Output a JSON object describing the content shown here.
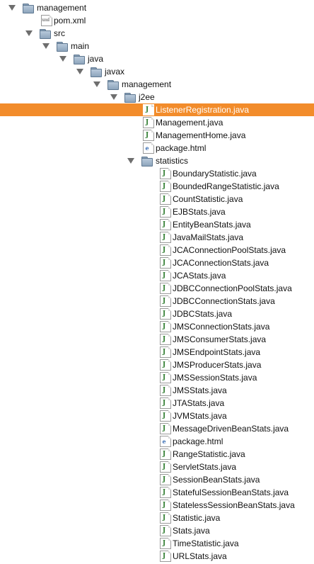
{
  "tree": {
    "items": [
      {
        "label": "management",
        "kind": "folder",
        "depth": 0,
        "expanded": true,
        "icon": "folder-icon",
        "selected": false
      },
      {
        "label": "pom.xml",
        "kind": "file",
        "filetype": "xml",
        "depth": 1,
        "icon": "xml-file-icon",
        "selected": false
      },
      {
        "label": "src",
        "kind": "folder",
        "depth": 1,
        "expanded": true,
        "icon": "folder-icon",
        "selected": false
      },
      {
        "label": "main",
        "kind": "folder",
        "depth": 2,
        "expanded": true,
        "icon": "folder-icon",
        "selected": false
      },
      {
        "label": "java",
        "kind": "folder",
        "depth": 3,
        "expanded": true,
        "icon": "folder-icon",
        "selected": false
      },
      {
        "label": "javax",
        "kind": "folder",
        "depth": 4,
        "expanded": true,
        "icon": "folder-icon",
        "selected": false
      },
      {
        "label": "management",
        "kind": "folder",
        "depth": 5,
        "expanded": true,
        "icon": "folder-icon",
        "selected": false
      },
      {
        "label": "j2ee",
        "kind": "folder",
        "depth": 6,
        "expanded": true,
        "icon": "folder-icon",
        "selected": false
      },
      {
        "label": "ListenerRegistration.java",
        "kind": "file",
        "filetype": "java",
        "depth": 7,
        "icon": "java-file-icon",
        "selected": true
      },
      {
        "label": "Management.java",
        "kind": "file",
        "filetype": "java",
        "depth": 7,
        "icon": "java-file-icon",
        "selected": false
      },
      {
        "label": "ManagementHome.java",
        "kind": "file",
        "filetype": "java",
        "depth": 7,
        "icon": "java-file-icon",
        "selected": false
      },
      {
        "label": "package.html",
        "kind": "file",
        "filetype": "html",
        "depth": 7,
        "icon": "html-file-icon",
        "selected": false
      },
      {
        "label": "statistics",
        "kind": "folder",
        "depth": 7,
        "expanded": true,
        "icon": "folder-icon",
        "selected": false
      },
      {
        "label": "BoundaryStatistic.java",
        "kind": "file",
        "filetype": "java",
        "depth": 8,
        "icon": "java-file-icon",
        "selected": false
      },
      {
        "label": "BoundedRangeStatistic.java",
        "kind": "file",
        "filetype": "java",
        "depth": 8,
        "icon": "java-file-icon",
        "selected": false
      },
      {
        "label": "CountStatistic.java",
        "kind": "file",
        "filetype": "java",
        "depth": 8,
        "icon": "java-file-icon",
        "selected": false
      },
      {
        "label": "EJBStats.java",
        "kind": "file",
        "filetype": "java",
        "depth": 8,
        "icon": "java-file-icon",
        "selected": false
      },
      {
        "label": "EntityBeanStats.java",
        "kind": "file",
        "filetype": "java",
        "depth": 8,
        "icon": "java-file-icon",
        "selected": false
      },
      {
        "label": "JavaMailStats.java",
        "kind": "file",
        "filetype": "java",
        "depth": 8,
        "icon": "java-file-icon",
        "selected": false
      },
      {
        "label": "JCAConnectionPoolStats.java",
        "kind": "file",
        "filetype": "java",
        "depth": 8,
        "icon": "java-file-icon",
        "selected": false
      },
      {
        "label": "JCAConnectionStats.java",
        "kind": "file",
        "filetype": "java",
        "depth": 8,
        "icon": "java-file-icon",
        "selected": false
      },
      {
        "label": "JCAStats.java",
        "kind": "file",
        "filetype": "java",
        "depth": 8,
        "icon": "java-file-icon",
        "selected": false
      },
      {
        "label": "JDBCConnectionPoolStats.java",
        "kind": "file",
        "filetype": "java",
        "depth": 8,
        "icon": "java-file-icon",
        "selected": false
      },
      {
        "label": "JDBCConnectionStats.java",
        "kind": "file",
        "filetype": "java",
        "depth": 8,
        "icon": "java-file-icon",
        "selected": false
      },
      {
        "label": "JDBCStats.java",
        "kind": "file",
        "filetype": "java",
        "depth": 8,
        "icon": "java-file-icon",
        "selected": false
      },
      {
        "label": "JMSConnectionStats.java",
        "kind": "file",
        "filetype": "java",
        "depth": 8,
        "icon": "java-file-icon",
        "selected": false
      },
      {
        "label": "JMSConsumerStats.java",
        "kind": "file",
        "filetype": "java",
        "depth": 8,
        "icon": "java-file-icon",
        "selected": false
      },
      {
        "label": "JMSEndpointStats.java",
        "kind": "file",
        "filetype": "java",
        "depth": 8,
        "icon": "java-file-icon",
        "selected": false
      },
      {
        "label": "JMSProducerStats.java",
        "kind": "file",
        "filetype": "java",
        "depth": 8,
        "icon": "java-file-icon",
        "selected": false
      },
      {
        "label": "JMSSessionStats.java",
        "kind": "file",
        "filetype": "java",
        "depth": 8,
        "icon": "java-file-icon",
        "selected": false
      },
      {
        "label": "JMSStats.java",
        "kind": "file",
        "filetype": "java",
        "depth": 8,
        "icon": "java-file-icon",
        "selected": false
      },
      {
        "label": "JTAStats.java",
        "kind": "file",
        "filetype": "java",
        "depth": 8,
        "icon": "java-file-icon",
        "selected": false
      },
      {
        "label": "JVMStats.java",
        "kind": "file",
        "filetype": "java",
        "depth": 8,
        "icon": "java-file-icon",
        "selected": false
      },
      {
        "label": "MessageDrivenBeanStats.java",
        "kind": "file",
        "filetype": "java",
        "depth": 8,
        "icon": "java-file-icon",
        "selected": false
      },
      {
        "label": "package.html",
        "kind": "file",
        "filetype": "html",
        "depth": 8,
        "icon": "html-file-icon",
        "selected": false
      },
      {
        "label": "RangeStatistic.java",
        "kind": "file",
        "filetype": "java",
        "depth": 8,
        "icon": "java-file-icon",
        "selected": false
      },
      {
        "label": "ServletStats.java",
        "kind": "file",
        "filetype": "java",
        "depth": 8,
        "icon": "java-file-icon",
        "selected": false
      },
      {
        "label": "SessionBeanStats.java",
        "kind": "file",
        "filetype": "java",
        "depth": 8,
        "icon": "java-file-icon",
        "selected": false
      },
      {
        "label": "StatefulSessionBeanStats.java",
        "kind": "file",
        "filetype": "java",
        "depth": 8,
        "icon": "java-file-icon",
        "selected": false
      },
      {
        "label": "StatelessSessionBeanStats.java",
        "kind": "file",
        "filetype": "java",
        "depth": 8,
        "icon": "java-file-icon",
        "selected": false
      },
      {
        "label": "Statistic.java",
        "kind": "file",
        "filetype": "java",
        "depth": 8,
        "icon": "java-file-icon",
        "selected": false
      },
      {
        "label": "Stats.java",
        "kind": "file",
        "filetype": "java",
        "depth": 8,
        "icon": "java-file-icon",
        "selected": false
      },
      {
        "label": "TimeStatistic.java",
        "kind": "file",
        "filetype": "java",
        "depth": 8,
        "icon": "java-file-icon",
        "selected": false
      },
      {
        "label": "URLStats.java",
        "kind": "file",
        "filetype": "java",
        "depth": 8,
        "icon": "java-file-icon",
        "selected": false
      }
    ]
  },
  "icons": {
    "java-file-icon": "J",
    "xml-file-icon": "xml",
    "html-file-icon": "e",
    "folder-icon": "folder",
    "disclosure-expanded-icon": "triangle-down"
  },
  "colors": {
    "selection": "#f28c2b",
    "selection_text": "#ffffff",
    "java_glyph": "#2f7d2f",
    "folder": "#9bb1c7"
  }
}
